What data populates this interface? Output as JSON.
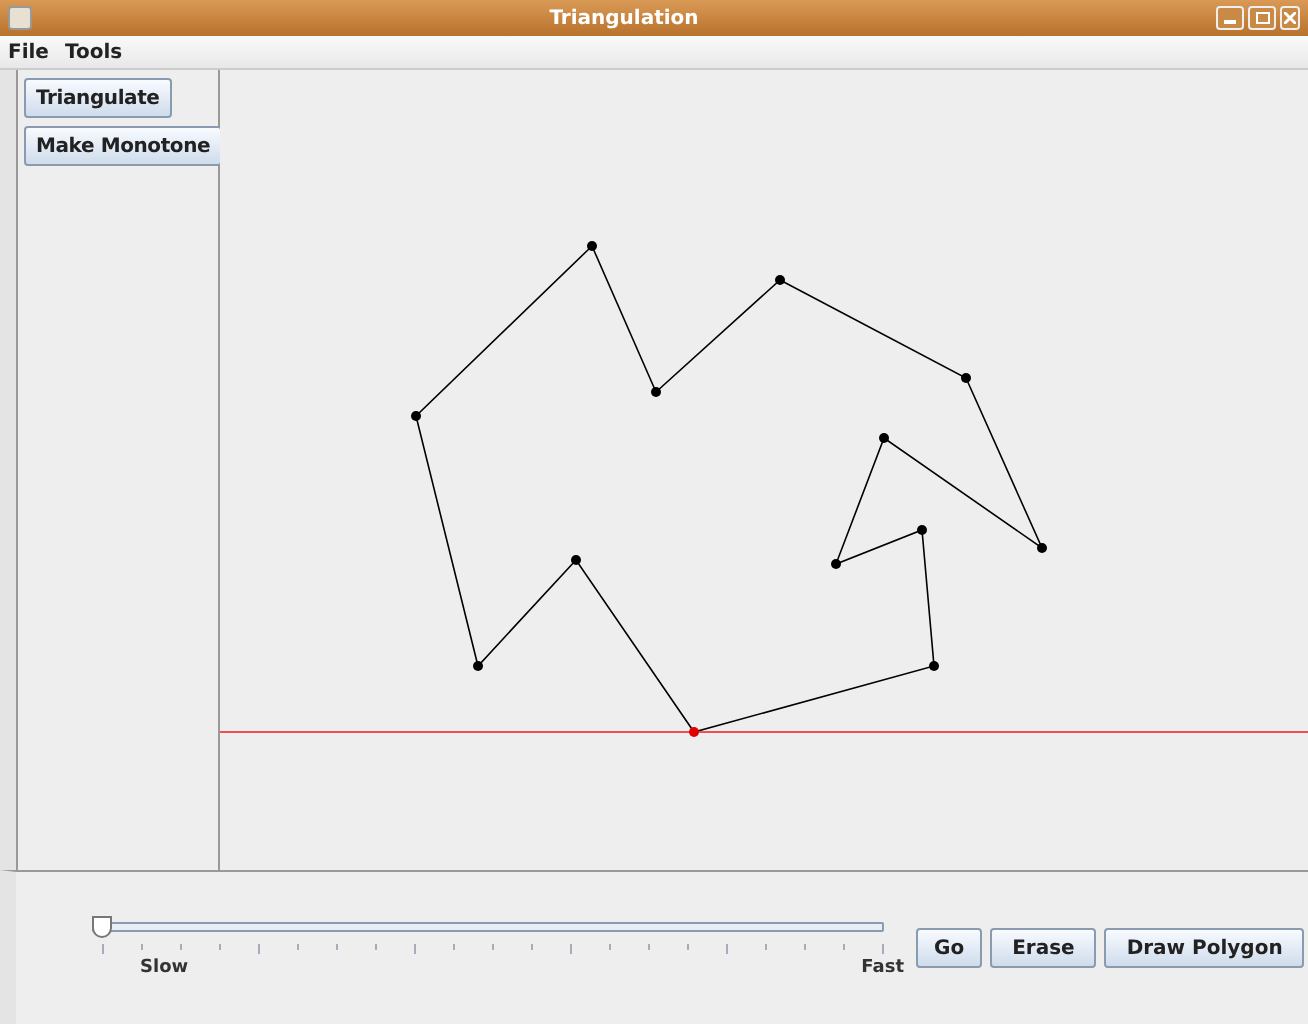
{
  "window": {
    "title": "Triangulation"
  },
  "menu": [
    "File",
    "Tools"
  ],
  "side_buttons": [
    "Triangulate",
    "Make Monotone"
  ],
  "slider": {
    "level": 0,
    "min_label": "Slow",
    "max_label": "Fast"
  },
  "buttons": [
    "Go",
    "Erase",
    "Draw Polygon"
  ]
}
